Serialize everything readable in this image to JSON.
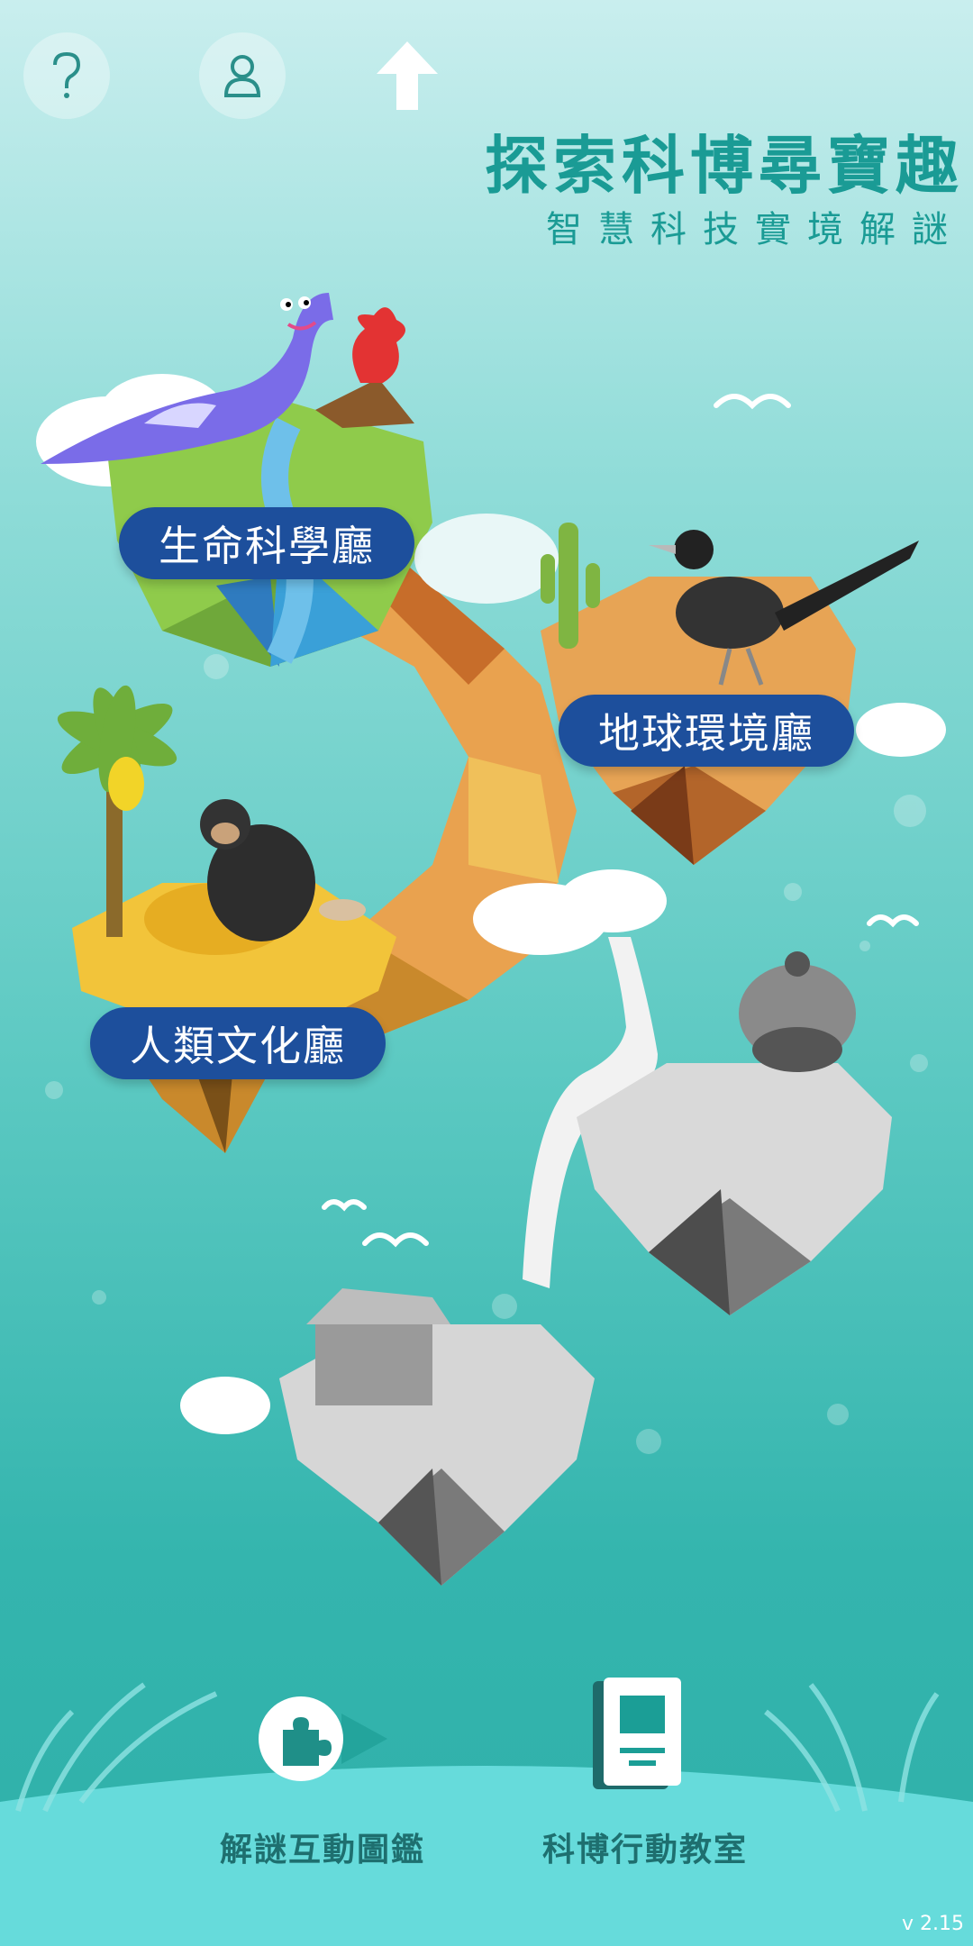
{
  "header": {
    "help_icon": "question-mark",
    "profile_icon": "user-icon",
    "up_icon": "arrow-up",
    "title": "探索科博尋寶趣",
    "subtitle": "智慧科技實境解謎"
  },
  "halls": [
    {
      "label": "生命科學廳"
    },
    {
      "label": "地球環境廳"
    },
    {
      "label": "人類文化廳"
    }
  ],
  "bottom_nav": {
    "puzzle_label": "解謎互動圖鑑",
    "classroom_label": "科博行動教室"
  },
  "version": "v 2.15",
  "colors": {
    "accent": "#1a9b95",
    "pill": "#1d4f9c",
    "nav_text": "#1e6f6f"
  }
}
